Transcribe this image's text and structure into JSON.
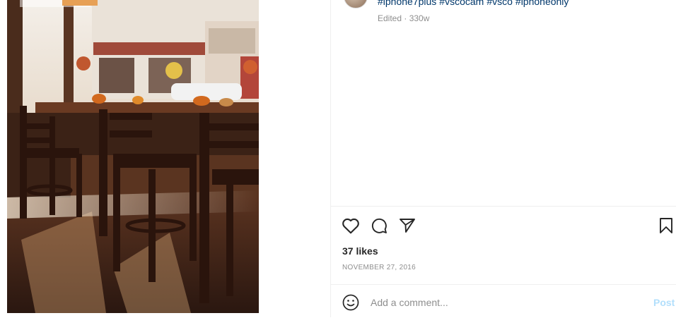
{
  "post": {
    "hashtags": [
      "#iphone7plus",
      "#vscocam",
      "#vsco",
      "#iphoneonly"
    ],
    "edited_label": "Edited · 330w",
    "likes_label": "37 likes",
    "date_label": "NOVEMBER 27, 2016"
  },
  "actions": {
    "like_icon": "heart-icon",
    "comment_icon": "comment-icon",
    "share_icon": "paper-plane-icon",
    "save_icon": "bookmark-icon"
  },
  "comment": {
    "placeholder": "Add a comment...",
    "post_label": "Post",
    "emoji_icon": "smiley-icon"
  },
  "colors": {
    "hashtag": "#00376b",
    "muted": "#8e8e8e",
    "post_disabled": "#b2dffc",
    "divider": "#efefef"
  }
}
